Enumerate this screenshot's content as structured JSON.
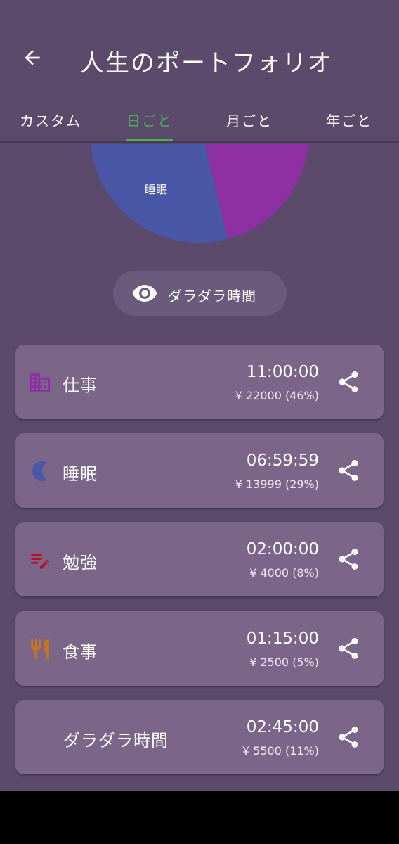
{
  "appbar": {
    "title": "人生のポートフォリオ",
    "back_icon": "arrow-back-icon"
  },
  "tabs": [
    {
      "label": "カスタム",
      "active": false
    },
    {
      "label": "日ごと",
      "active": true
    },
    {
      "label": "月ごと",
      "active": false
    },
    {
      "label": "年ごと",
      "active": false
    }
  ],
  "colors": {
    "background": "#5b4a6c",
    "card": "#7b6689",
    "active_tab": "#4caf50",
    "sleep": "#4a56a6",
    "work": "#8e2fa3",
    "study": "#b5122a",
    "meal": "#c77518"
  },
  "pie": {
    "visible_label": "睡眠"
  },
  "filter_chip": {
    "label": "ダラダラ時間",
    "icon": "eye-icon"
  },
  "items": [
    {
      "name": "仕事",
      "time": "11:00:00",
      "money": "¥ 22000 (46%)",
      "icon": "building-icon",
      "color": "#8e2fa3"
    },
    {
      "name": "睡眠",
      "time": "06:59:59",
      "money": "¥ 13999 (29%)",
      "icon": "moon-icon",
      "color": "#4a56a6"
    },
    {
      "name": "勉強",
      "time": "02:00:00",
      "money": "¥ 4000 (8%)",
      "icon": "edit-note-icon",
      "color": "#b5122a"
    },
    {
      "name": "食事",
      "time": "01:15:00",
      "money": "¥ 2500 (5%)",
      "icon": "restaurant-icon",
      "color": "#c77518"
    },
    {
      "name": "ダラダラ時間",
      "time": "02:45:00",
      "money": "¥ 5500 (11%)",
      "icon": "",
      "color": ""
    }
  ]
}
